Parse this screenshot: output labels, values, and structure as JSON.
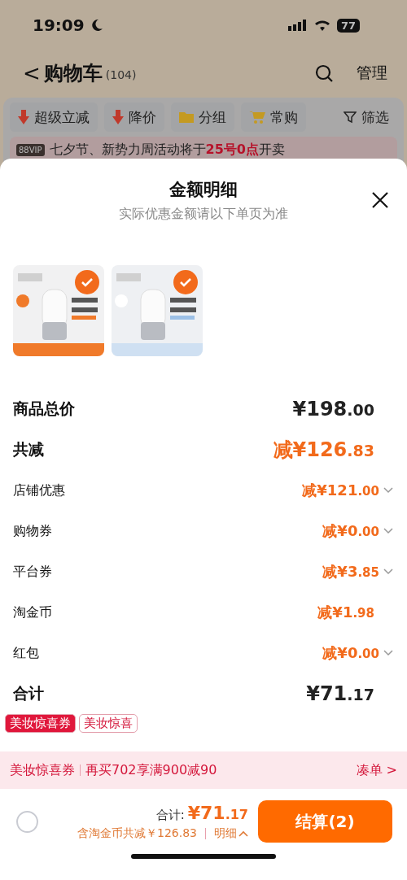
{
  "status_bar": {
    "time": "19:09",
    "battery": "77"
  },
  "nav": {
    "back": "<",
    "title": "购物车",
    "count": "(104)",
    "manage": "管理"
  },
  "toolbar": [
    {
      "label": "超级立减"
    },
    {
      "label": "降价"
    },
    {
      "label": "分组"
    },
    {
      "label": "常购"
    },
    {
      "label": "筛选"
    }
  ],
  "notice": {
    "badge": "88VIP",
    "text": "七夕节、新势力周活动将于**25号0点**开卖"
  },
  "sheet": {
    "title": "金额明细",
    "subtitle": "实际优惠金额请以下单页为准",
    "products": [
      {
        "checked": true
      },
      {
        "checked": true
      }
    ],
    "rows": [
      {
        "label": "商品总价",
        "kind": "total",
        "prefix": "¥",
        "amount": "198",
        "cents": ".00",
        "expandable": false
      },
      {
        "label": "共减",
        "kind": "discount-total",
        "prefix": "减¥",
        "amount": "126",
        "cents": ".83",
        "expandable": false
      },
      {
        "label": "店铺优惠",
        "kind": "discount",
        "prefix": "减¥",
        "amount": "121",
        "cents": ".00",
        "expandable": true
      },
      {
        "label": "购物券",
        "kind": "discount",
        "prefix": "减¥",
        "amount": "0",
        "cents": ".00",
        "expandable": true
      },
      {
        "label": "平台券",
        "kind": "discount",
        "prefix": "减¥",
        "amount": "3",
        "cents": ".85",
        "expandable": true
      },
      {
        "label": "淘金币",
        "kind": "discount",
        "prefix": "减¥",
        "amount": "1",
        "cents": ".98",
        "expandable": false
      },
      {
        "label": "红包",
        "kind": "discount",
        "prefix": "减¥",
        "amount": "0",
        "cents": ".00",
        "expandable": true
      },
      {
        "label": "合计",
        "kind": "total",
        "prefix": "¥",
        "amount": "71",
        "cents": ".17",
        "expandable": false
      }
    ]
  },
  "coupon_tags": [
    {
      "label": "美妆惊喜券",
      "selected": true
    },
    {
      "label": "美妆惊喜",
      "selected": false
    }
  ],
  "coupon_bar": {
    "name": "美妆惊喜券",
    "offer": "再买702享满900减90",
    "action": "凑单",
    "arrow": ">"
  },
  "checkout": {
    "select_all_checked": false,
    "total_label": "合计:",
    "total_prefix": "¥",
    "total_amount": "71",
    "total_cents": ".17",
    "savings": "含淘金币共减￥126.83",
    "details": "明细",
    "button": "结算(2)"
  }
}
